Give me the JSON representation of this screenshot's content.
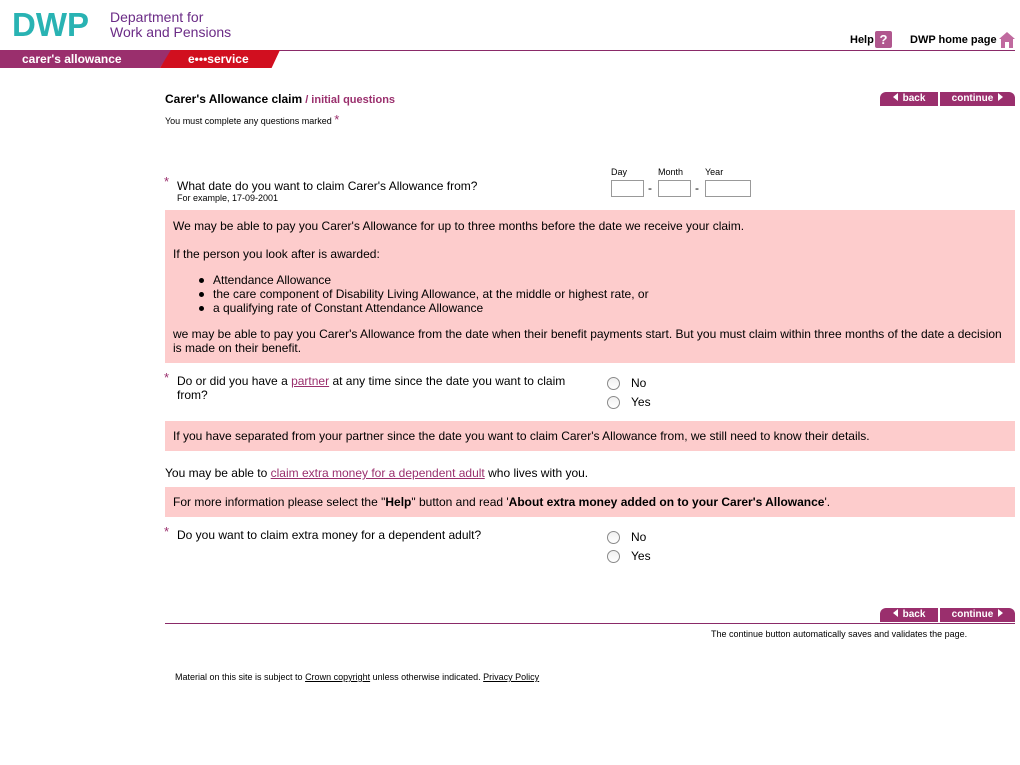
{
  "header": {
    "logo": "DWP",
    "dept_line1": "Department for",
    "dept_line2": "Work and Pensions",
    "help_label": "Help",
    "home_label": "DWP home page",
    "tab_carer": "carer's allowance",
    "tab_eservice": "e•••service"
  },
  "title": {
    "main": "Carer's Allowance claim",
    "sub": " / initial questions"
  },
  "nav": {
    "back": "back",
    "continue": "continue"
  },
  "mandatory_note": "You must complete any questions marked",
  "star": "*",
  "q1": {
    "text": "What date do you want to claim Carer's Allowance from?",
    "example": "For example, 17-09-2001",
    "day_label": "Day",
    "month_label": "Month",
    "year_label": "Year",
    "dash": "-",
    "day_value": "",
    "month_value": "",
    "year_value": ""
  },
  "info1": {
    "p1": "We may be able to pay you Carer's Allowance for up to three months before the date we receive your claim.",
    "p2": "If the person you look after is awarded:",
    "items": [
      "Attendance Allowance",
      "the care component of Disability Living Allowance, at the middle or highest rate, or",
      "a qualifying rate of Constant Attendance Allowance"
    ],
    "p3": "we may be able to pay you Carer's Allowance from the date when their benefit payments start. But you must claim within three months of the date a decision is made on their benefit."
  },
  "q2": {
    "pre": "Do or did you have a ",
    "link": "partner",
    "post": " at any time since the date you want to claim",
    "line2": "from?",
    "opt_no": "No",
    "opt_yes": "Yes"
  },
  "info2": "If you have separated from your partner since the date you want to claim Carer's Allowance from, we still need to know their details.",
  "extra": {
    "pre": "You may be able to ",
    "link": "claim extra money for a dependent adult",
    "post": " who lives with you."
  },
  "info3": {
    "pre": "For more information please select the \"",
    "help": "Help",
    "mid": "\" button and read '",
    "bold": "About extra money added on to your Carer's Allowance",
    "post": "'."
  },
  "q3": {
    "text": "Do you want to claim extra money for a dependent adult?",
    "opt_no": "No",
    "opt_yes": "Yes"
  },
  "auto_note": "The continue button automatically saves and validates the page.",
  "footer": {
    "pre": "Material on this site is subject to ",
    "crown": "Crown copyright",
    "mid": " unless otherwise indicated. ",
    "privacy": "Privacy Policy"
  },
  "colors": {
    "brand_teal": "#29b3b3",
    "brand_purple": "#9a2f6d",
    "eservice_red": "#d10f1f",
    "info_pink": "#fdcccc"
  }
}
